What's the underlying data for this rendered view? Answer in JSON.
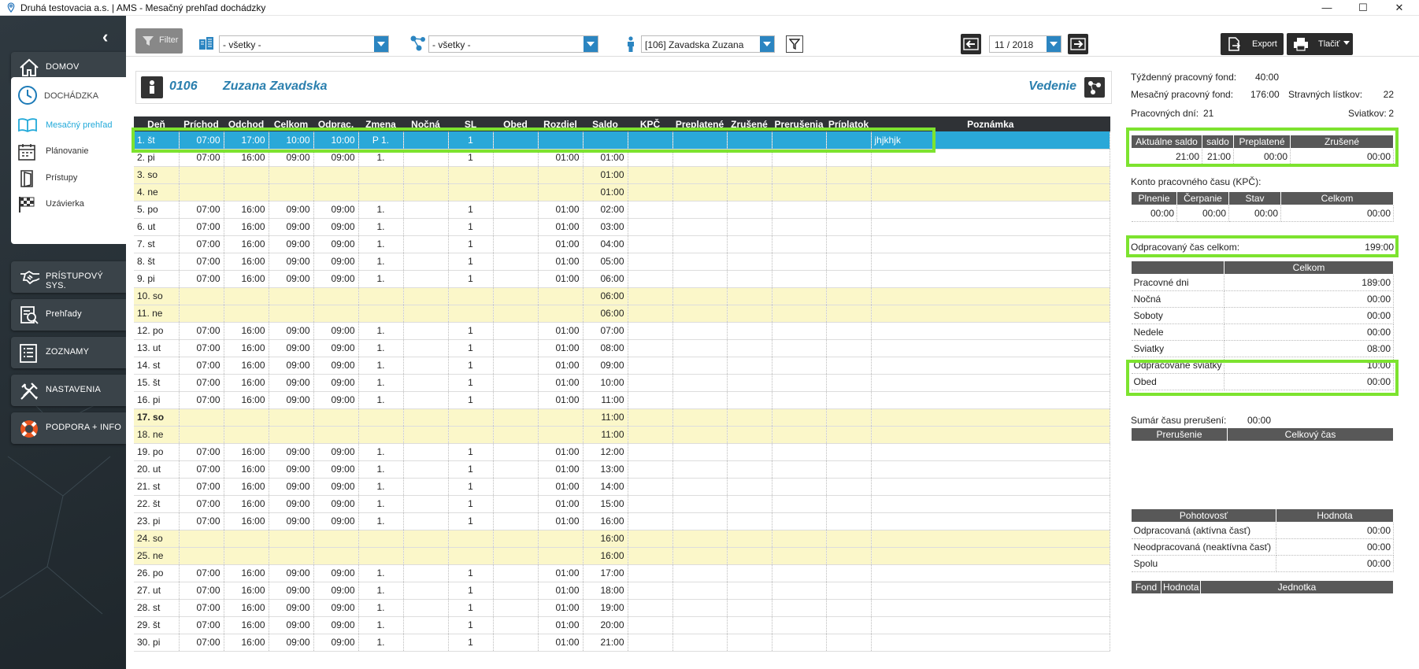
{
  "window": {
    "title": "Druhá testovacia a.s. | AMS - Mesačný prehľad dochádzky",
    "minimize": "—",
    "maximize": "☐",
    "close": "✕"
  },
  "sidebar": {
    "collapse": "‹",
    "domov": "DOMOV",
    "dochadzka": "DOCHÁDZKA",
    "sub": [
      "Mesačný prehľad",
      "Plánovanie",
      "Prístupy",
      "Uzávierka"
    ],
    "nav": [
      "PRÍSTUPOVÝ SYS.",
      "Prehľady",
      "ZOZNAMY",
      "NASTAVENIA",
      "PODPORA + INFO"
    ],
    "accent": "#21a9d9"
  },
  "toolbar": {
    "filter_label": "Filter",
    "building_value": "- všetky -",
    "structure_value": "- všetky -",
    "employee_value": "[106] Zavadska Zuzana",
    "period_value": "11 / 2018",
    "export_label": "Export",
    "print_label": "Tlačiť"
  },
  "employee": {
    "code": "0106",
    "name": "Zuzana Zavadska",
    "department": "Vedenie"
  },
  "table": {
    "columns": [
      "Deň",
      "Príchod",
      "Odchod",
      "Celkom",
      "Odprac.",
      "Zmena",
      "Nočná",
      "SL",
      "Obed",
      "Rozdiel",
      "Saldo",
      "KPČ",
      "Preplatené",
      "Zrušené",
      "Prerušenia",
      "Príplatok",
      "Poznámka"
    ],
    "rows": [
      {
        "d": "1. št",
        "p": "07:00",
        "o": "17:00",
        "c": "10:00",
        "od": "10:00",
        "z": "P 1.",
        "sl": "1",
        "r": "",
        "s": "",
        "n": "jhjkhjk",
        "t": "sel"
      },
      {
        "d": "2. pi",
        "p": "07:00",
        "o": "16:00",
        "c": "09:00",
        "od": "09:00",
        "z": "1.",
        "sl": "1",
        "r": "01:00",
        "s": "01:00",
        "n": "",
        "t": ""
      },
      {
        "d": "3. so",
        "p": "",
        "o": "",
        "c": "",
        "od": "",
        "z": "",
        "sl": "",
        "r": "",
        "s": "01:00",
        "n": "",
        "t": "we"
      },
      {
        "d": "4. ne",
        "p": "",
        "o": "",
        "c": "",
        "od": "",
        "z": "",
        "sl": "",
        "r": "",
        "s": "01:00",
        "n": "",
        "t": "we"
      },
      {
        "d": "5. po",
        "p": "07:00",
        "o": "16:00",
        "c": "09:00",
        "od": "09:00",
        "z": "1.",
        "sl": "1",
        "r": "01:00",
        "s": "02:00",
        "n": "",
        "t": ""
      },
      {
        "d": "6. ut",
        "p": "07:00",
        "o": "16:00",
        "c": "09:00",
        "od": "09:00",
        "z": "1.",
        "sl": "1",
        "r": "01:00",
        "s": "03:00",
        "n": "",
        "t": ""
      },
      {
        "d": "7. st",
        "p": "07:00",
        "o": "16:00",
        "c": "09:00",
        "od": "09:00",
        "z": "1.",
        "sl": "1",
        "r": "01:00",
        "s": "04:00",
        "n": "",
        "t": ""
      },
      {
        "d": "8. št",
        "p": "07:00",
        "o": "16:00",
        "c": "09:00",
        "od": "09:00",
        "z": "1.",
        "sl": "1",
        "r": "01:00",
        "s": "05:00",
        "n": "",
        "t": ""
      },
      {
        "d": "9. pi",
        "p": "07:00",
        "o": "16:00",
        "c": "09:00",
        "od": "09:00",
        "z": "1.",
        "sl": "1",
        "r": "01:00",
        "s": "06:00",
        "n": "",
        "t": ""
      },
      {
        "d": "10. so",
        "p": "",
        "o": "",
        "c": "",
        "od": "",
        "z": "",
        "sl": "",
        "r": "",
        "s": "06:00",
        "n": "",
        "t": "we"
      },
      {
        "d": "11. ne",
        "p": "",
        "o": "",
        "c": "",
        "od": "",
        "z": "",
        "sl": "",
        "r": "",
        "s": "06:00",
        "n": "",
        "t": "we"
      },
      {
        "d": "12. po",
        "p": "07:00",
        "o": "16:00",
        "c": "09:00",
        "od": "09:00",
        "z": "1.",
        "sl": "1",
        "r": "01:00",
        "s": "07:00",
        "n": "",
        "t": ""
      },
      {
        "d": "13. ut",
        "p": "07:00",
        "o": "16:00",
        "c": "09:00",
        "od": "09:00",
        "z": "1.",
        "sl": "1",
        "r": "01:00",
        "s": "08:00",
        "n": "",
        "t": ""
      },
      {
        "d": "14. st",
        "p": "07:00",
        "o": "16:00",
        "c": "09:00",
        "od": "09:00",
        "z": "1.",
        "sl": "1",
        "r": "01:00",
        "s": "09:00",
        "n": "",
        "t": ""
      },
      {
        "d": "15. št",
        "p": "07:00",
        "o": "16:00",
        "c": "09:00",
        "od": "09:00",
        "z": "1.",
        "sl": "1",
        "r": "01:00",
        "s": "10:00",
        "n": "",
        "t": ""
      },
      {
        "d": "16. pi",
        "p": "07:00",
        "o": "16:00",
        "c": "09:00",
        "od": "09:00",
        "z": "1.",
        "sl": "1",
        "r": "01:00",
        "s": "11:00",
        "n": "",
        "t": ""
      },
      {
        "d": "17. so",
        "p": "",
        "o": "",
        "c": "",
        "od": "",
        "z": "",
        "sl": "",
        "r": "",
        "s": "11:00",
        "n": "",
        "t": "we bold"
      },
      {
        "d": "18. ne",
        "p": "",
        "o": "",
        "c": "",
        "od": "",
        "z": "",
        "sl": "",
        "r": "",
        "s": "11:00",
        "n": "",
        "t": "we"
      },
      {
        "d": "19. po",
        "p": "07:00",
        "o": "16:00",
        "c": "09:00",
        "od": "09:00",
        "z": "1.",
        "sl": "1",
        "r": "01:00",
        "s": "12:00",
        "n": "",
        "t": ""
      },
      {
        "d": "20. ut",
        "p": "07:00",
        "o": "16:00",
        "c": "09:00",
        "od": "09:00",
        "z": "1.",
        "sl": "1",
        "r": "01:00",
        "s": "13:00",
        "n": "",
        "t": ""
      },
      {
        "d": "21. st",
        "p": "07:00",
        "o": "16:00",
        "c": "09:00",
        "od": "09:00",
        "z": "1.",
        "sl": "1",
        "r": "01:00",
        "s": "14:00",
        "n": "",
        "t": ""
      },
      {
        "d": "22. št",
        "p": "07:00",
        "o": "16:00",
        "c": "09:00",
        "od": "09:00",
        "z": "1.",
        "sl": "1",
        "r": "01:00",
        "s": "15:00",
        "n": "",
        "t": ""
      },
      {
        "d": "23. pi",
        "p": "07:00",
        "o": "16:00",
        "c": "09:00",
        "od": "09:00",
        "z": "1.",
        "sl": "1",
        "r": "01:00",
        "s": "16:00",
        "n": "",
        "t": ""
      },
      {
        "d": "24. so",
        "p": "",
        "o": "",
        "c": "",
        "od": "",
        "z": "",
        "sl": "",
        "r": "",
        "s": "16:00",
        "n": "",
        "t": "we"
      },
      {
        "d": "25. ne",
        "p": "",
        "o": "",
        "c": "",
        "od": "",
        "z": "",
        "sl": "",
        "r": "",
        "s": "16:00",
        "n": "",
        "t": "we"
      },
      {
        "d": "26. po",
        "p": "07:00",
        "o": "16:00",
        "c": "09:00",
        "od": "09:00",
        "z": "1.",
        "sl": "1",
        "r": "01:00",
        "s": "17:00",
        "n": "",
        "t": ""
      },
      {
        "d": "27. ut",
        "p": "07:00",
        "o": "16:00",
        "c": "09:00",
        "od": "09:00",
        "z": "1.",
        "sl": "1",
        "r": "01:00",
        "s": "18:00",
        "n": "",
        "t": ""
      },
      {
        "d": "28. st",
        "p": "07:00",
        "o": "16:00",
        "c": "09:00",
        "od": "09:00",
        "z": "1.",
        "sl": "1",
        "r": "01:00",
        "s": "19:00",
        "n": "",
        "t": ""
      },
      {
        "d": "29. št",
        "p": "07:00",
        "o": "16:00",
        "c": "09:00",
        "od": "09:00",
        "z": "1.",
        "sl": "1",
        "r": "01:00",
        "s": "20:00",
        "n": "",
        "t": ""
      },
      {
        "d": "30. pi",
        "p": "07:00",
        "o": "16:00",
        "c": "09:00",
        "od": "09:00",
        "z": "1.",
        "sl": "1",
        "r": "01:00",
        "s": "21:00",
        "n": "",
        "t": ""
      }
    ]
  },
  "summary": {
    "weekly_fund_label": "Týždenný pracovný fond:",
    "weekly_fund_value": "40:00",
    "monthly_fund_label": "Mesačný pracovný fond:",
    "monthly_fund_value": "176:00",
    "meal_label": "Stravných lístkov:",
    "meal_value": "22",
    "workdays_label": "Pracovných dní:",
    "workdays_value": "21",
    "holidays_label": "Sviatkov:",
    "holidays_value": "2",
    "balance_headers": [
      "Aktuálne saldo",
      "saldo",
      "Preplatené",
      "Zrušené"
    ],
    "balance_values": [
      "21:00",
      "21:00",
      "00:00",
      "00:00"
    ],
    "kpc_title": "Konto pracovného času (KPČ):",
    "kpc_headers": [
      "Plnenie",
      "Čerpanie",
      "Stav",
      "Celkom"
    ],
    "kpc_values": [
      "00:00",
      "00:00",
      "00:00",
      "00:00"
    ],
    "worked_label": "Odpracovaný čas celkom:",
    "worked_value": "199:00",
    "breakdown_header": "Celkom",
    "breakdown": [
      {
        "k": "Pracovné dni",
        "v": "189:00"
      },
      {
        "k": "Nočná",
        "v": "00:00"
      },
      {
        "k": "Soboty",
        "v": "00:00"
      },
      {
        "k": "Nedele",
        "v": "00:00"
      },
      {
        "k": "Sviatky",
        "v": "08:00"
      },
      {
        "k": "Odpracované sviatky",
        "v": "10:00"
      },
      {
        "k": "Obed",
        "v": "00:00"
      }
    ],
    "interrupt_sum_label": "Sumár času prerušení:",
    "interrupt_sum_value": "00:00",
    "interrupt_headers": [
      "Prerušenie",
      "Celkový čas"
    ],
    "standby_headers": [
      "Pohotovosť",
      "Hodnota"
    ],
    "standby": [
      {
        "k": "Odpracovaná (aktívna časť)",
        "v": "00:00"
      },
      {
        "k": "Neodpracovaná (neaktívna časť)",
        "v": "00:00"
      },
      {
        "k": "Spolu",
        "v": "00:00"
      }
    ],
    "fund_headers": [
      "Fond",
      "Hodnota",
      "Jednotka"
    ]
  }
}
